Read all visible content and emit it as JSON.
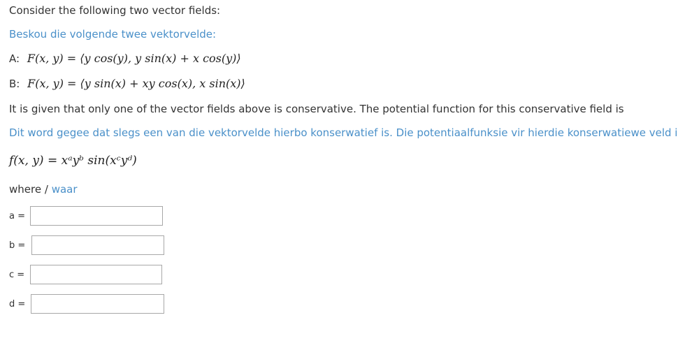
{
  "intro_en": "Consider the following two vector fields:",
  "intro_af": "Beskou die volgende twee vektorvelde:",
  "field_a": {
    "prefix": "A:",
    "formula": "F(x, y) = ⟨y cos(y), y sin(x) + x cos(y)⟩"
  },
  "field_b": {
    "prefix": "B:",
    "formula": "F(x, y) = ⟨y sin(x) + xy cos(x), x sin(x)⟩"
  },
  "given_en": "It is given that only one of the vector fields above is conservative. The potential function for this conservative field is",
  "given_af": "Dit word gegee dat slegs een van die vektorvelde hierbo konserwatief is. Die potentiaalfunksie vir hierdie konserwatiewe veld is",
  "potential_formula": "f(x, y) = xᵃyᵇ sin(xᶜyᵈ)",
  "where": {
    "en": "where",
    "separator": "/",
    "af": "waar"
  },
  "inputs": [
    {
      "label": "a =",
      "value": ""
    },
    {
      "label": "b =",
      "value": ""
    },
    {
      "label": "c =",
      "value": ""
    },
    {
      "label": "d =",
      "value": ""
    }
  ]
}
